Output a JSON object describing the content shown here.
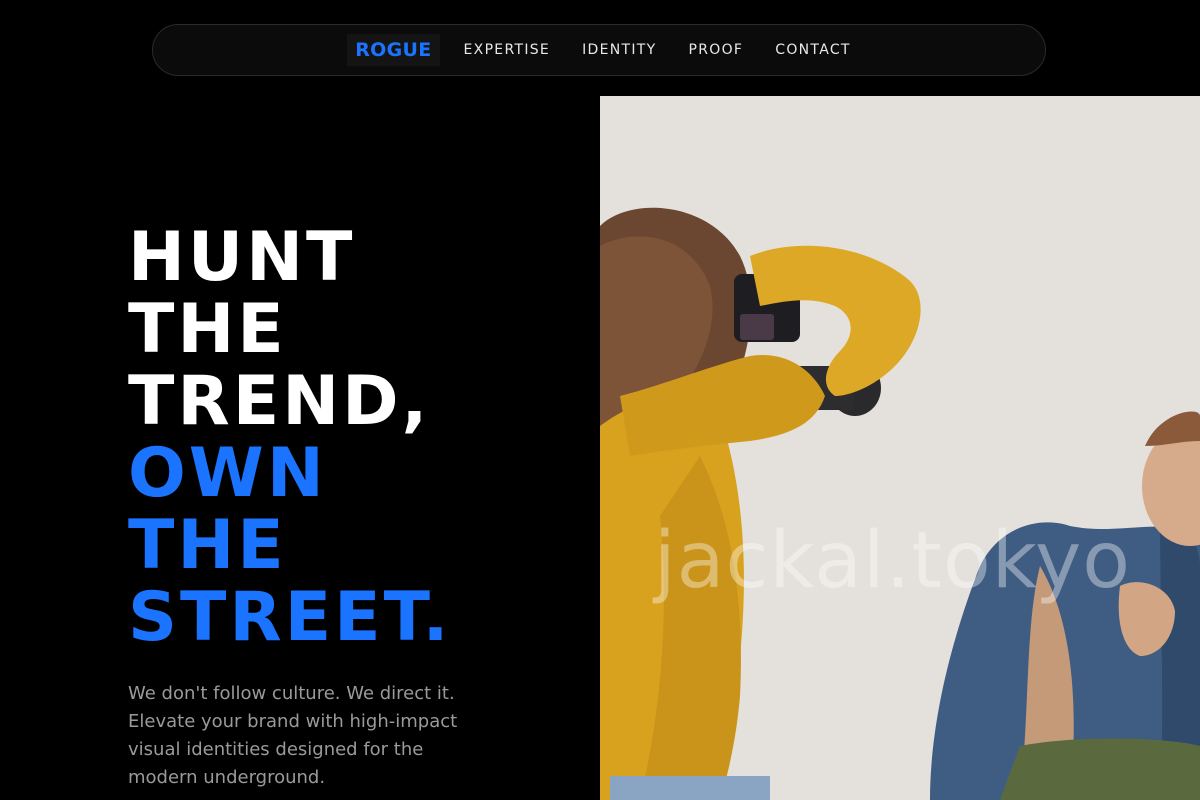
{
  "nav": {
    "brand": "ROGUE",
    "links": [
      "EXPERTISE",
      "IDENTITY",
      "PROOF",
      "CONTACT"
    ]
  },
  "hero": {
    "headline_white": [
      "HUNT",
      "THE",
      "TREND,"
    ],
    "headline_blue": [
      "OWN",
      "THE",
      "STREET."
    ],
    "subtext": "We don't follow culture. We direct it. Elevate your brand with high-impact visual identities designed for the modern underground.",
    "image_watermark": "jackal.tokyo"
  },
  "colors": {
    "background": "#000000",
    "accent": "#1a74ff",
    "text_primary": "#ffffff",
    "text_muted": "#9a9a9a"
  }
}
